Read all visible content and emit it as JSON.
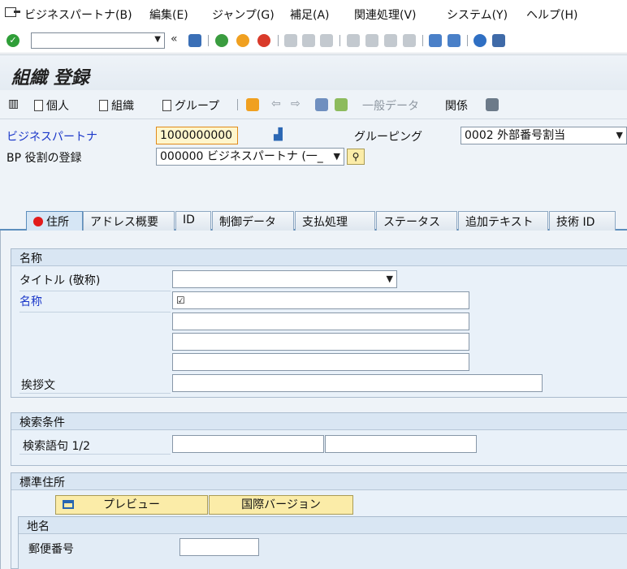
{
  "menu": [
    "ビジネスパートナ(B)",
    "編集(E)",
    "ジャンプ(G)",
    "補足(A)",
    "関連処理(V)",
    "システム(Y)",
    "ヘルプ(H)"
  ],
  "toolbar": {
    "command_value": "",
    "back_arrows": "«"
  },
  "title": "組織 登録",
  "app_toolbar": {
    "person": "個人",
    "organization": "組織",
    "group": "グループ",
    "general_data": "一般データ",
    "relations": "関係"
  },
  "header": {
    "bp_label": "ビジネスパートナ",
    "bp_value": "1000000000",
    "grouping_label": "グルーピング",
    "grouping_value": "0002 外部番号割当",
    "role_label": "BP 役割の登録",
    "role_value": "000000 ビジネスパートナ (一_"
  },
  "tabs": [
    "住所",
    "アドレス概要",
    "ID",
    "制御データ",
    "支払処理",
    "ステータス",
    "追加テキスト",
    "技術 ID"
  ],
  "name_group": {
    "title": "名称",
    "title_label": "タイトル (敬称)",
    "name_label": "名称",
    "name_check": "☑",
    "greeting_label": "挨拶文"
  },
  "search_group": {
    "title": "検索条件",
    "search_label": "検索語句 1/2"
  },
  "address_group": {
    "title": "標準住所",
    "preview": "プレビュー",
    "intl": "国際バージョン",
    "sub_title": "地名",
    "postal_label": "郵便番号"
  },
  "colors": {
    "accent": "#5c8ebd",
    "required": "#1a37c9",
    "button": "#fbeca8"
  }
}
